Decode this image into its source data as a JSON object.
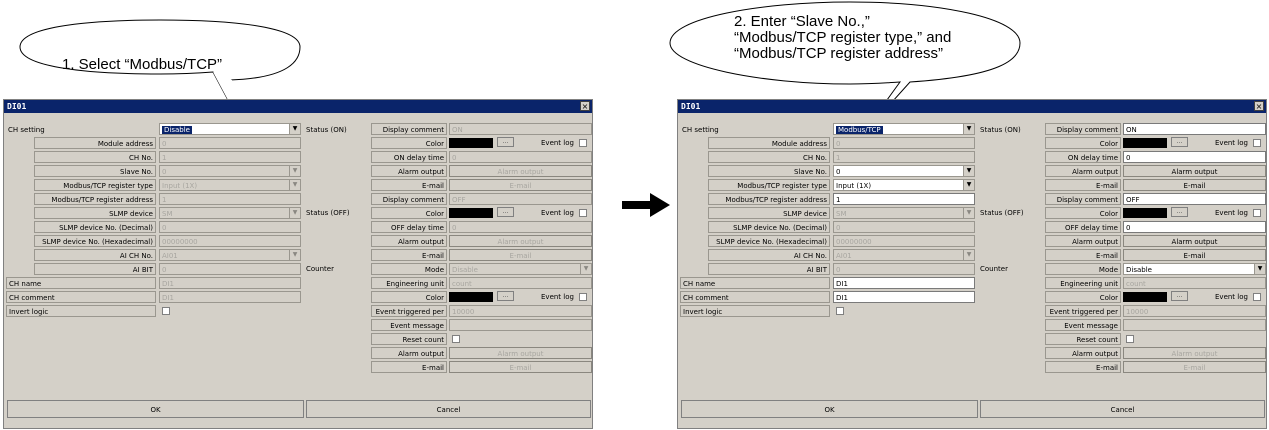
{
  "callouts": {
    "left": "1. Select “Modbus/TCP”",
    "right_lines": [
      "2. Enter “Slave No.,”",
      "“Modbus/TCP register type,” and",
      "“Modbus/TCP register address”"
    ]
  },
  "dialog": {
    "title": "DI01",
    "close_glyph": "×",
    "ok_label": "OK",
    "cancel_label": "Cancel",
    "labels": {
      "ch_setting": "CH setting",
      "module_address": "Module address",
      "ch_no": "CH No.",
      "slave_no": "Slave No.",
      "reg_type": "Modbus/TCP register type",
      "reg_addr": "Modbus/TCP register address",
      "slmp_device": "SLMP device",
      "slmp_dec": "SLMP device No. (Decimal)",
      "slmp_hex": "SLMP device No. (Hexadecimal)",
      "ai_ch_no": "AI CH No.",
      "ai_bit": "AI BIT",
      "ch_name": "CH name",
      "ch_comment": "CH comment",
      "invert_logic": "Invert logic",
      "status_on": "Status (ON)",
      "status_off": "Status (OFF)",
      "counter": "Counter",
      "display_comment": "Display comment",
      "color": "Color",
      "on_delay_time": "ON delay time",
      "off_delay_time": "OFF delay time",
      "alarm_output": "Alarm output",
      "email": "E-mail",
      "mode": "Mode",
      "eng_unit": "Engineering unit",
      "event_triggered": "Event triggered per",
      "event_message": "Event message",
      "reset_count": "Reset count",
      "event_log": "Event log",
      "color_btn": "..."
    }
  },
  "left_dialog": {
    "ch_setting": "Disable",
    "module_address": "0",
    "ch_no": "1",
    "slave_no": "0",
    "reg_type": "Input (1X)",
    "reg_addr": "1",
    "slmp_device": "SM",
    "slmp_dec": "0",
    "slmp_hex": "00000000",
    "ai_ch_no": "AI01",
    "ai_bit": "0",
    "ch_name": "DI1",
    "ch_comment": "DI1",
    "on_comment": "ON",
    "on_delay": "0",
    "on_alarm": "Alarm output",
    "on_email": "E-mail",
    "off_comment": "OFF",
    "off_delay": "0",
    "off_alarm": "Alarm output",
    "off_email": "E-mail",
    "mode": "Disable",
    "eng_unit": "count",
    "event_per": "10000",
    "cnt_alarm": "Alarm output",
    "cnt_email": "E-mail"
  },
  "right_dialog": {
    "ch_setting": "Modbus/TCP",
    "module_address": "0",
    "ch_no": "1",
    "slave_no": "0",
    "reg_type": "Input (1X)",
    "reg_addr": "1",
    "slmp_device": "SM",
    "slmp_dec": "0",
    "slmp_hex": "00000000",
    "ai_ch_no": "AI01",
    "ai_bit": "0",
    "ch_name": "DI1",
    "ch_comment": "DI1",
    "on_comment": "ON",
    "on_delay": "0",
    "on_alarm": "Alarm output",
    "on_email": "E-mail",
    "off_comment": "OFF",
    "off_delay": "0",
    "off_alarm": "Alarm output",
    "off_email": "E-mail",
    "mode": "Disable",
    "eng_unit": "count",
    "event_per": "10000",
    "cnt_alarm": "Alarm output",
    "cnt_email": "E-mail"
  }
}
